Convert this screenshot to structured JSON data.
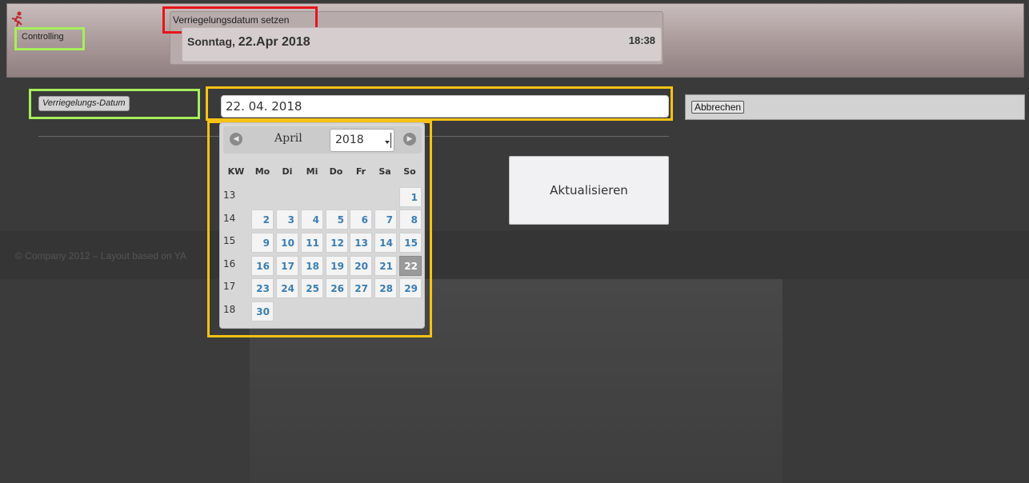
{
  "header": {
    "brand": "Controlling",
    "panel_title": "Verriegelungsdatum setzen",
    "date_prefix": "Sonntag, ",
    "date_main": "22.Apr 2018",
    "time": "18:38"
  },
  "form": {
    "label": "Verriegelungs-Datum",
    "date_value": "22. 04. 2018",
    "cancel": "Abbrechen",
    "update": "Aktualisieren"
  },
  "footer": {
    "text": "© Company 2012 – Layout based on YA"
  },
  "datepicker": {
    "month": "April",
    "year": "2018",
    "headers": [
      "KW",
      "Mo",
      "Di",
      "Mi",
      "Do",
      "Fr",
      "Sa",
      "So"
    ],
    "weeks": [
      "13",
      "14",
      "15",
      "16",
      "17",
      "18"
    ],
    "days": {
      "d1": "1",
      "d2": "2",
      "d3": "3",
      "d4": "4",
      "d5": "5",
      "d6": "6",
      "d7": "7",
      "d8": "8",
      "d9": "9",
      "d10": "10",
      "d11": "11",
      "d12": "12",
      "d13": "13",
      "d14": "14",
      "d15": "15",
      "d16": "16",
      "d17": "17",
      "d18": "18",
      "d19": "19",
      "d20": "20",
      "d21": "21",
      "d22": "22",
      "d23": "23",
      "d24": "24",
      "d25": "25",
      "d26": "26",
      "d27": "27",
      "d28": "28",
      "d29": "29",
      "d30": "30"
    },
    "selected_day": "22"
  },
  "colors": {
    "highlight_green": "#a6ef5a",
    "highlight_red": "#e8141c",
    "highlight_yellow": "#f7c214",
    "day_link": "#3a7fb4"
  },
  "icons": {
    "logo": "running-figure-icon",
    "prev": "arrow-left-circle-icon",
    "next": "arrow-right-circle-icon"
  }
}
